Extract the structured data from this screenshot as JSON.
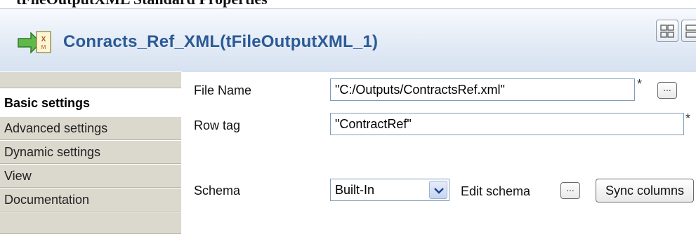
{
  "window": {
    "cut_heading": "tFileOutputXML Standard Properties",
    "title": "Conracts_Ref_XML(tFileOutputXML_1)",
    "view_buttons": [
      {
        "icon": "grid-view-icon"
      },
      {
        "icon": "list-view-icon"
      }
    ]
  },
  "sidebar": {
    "tabs": [
      {
        "label": "Basic settings",
        "active": true
      },
      {
        "label": "Advanced settings",
        "active": false
      },
      {
        "label": "Dynamic settings",
        "active": false
      },
      {
        "label": "View",
        "active": false
      },
      {
        "label": "Documentation",
        "active": false
      }
    ]
  },
  "form": {
    "file_name": {
      "label": "File Name",
      "value": "\"C:/Outputs/ContractsRef.xml\"",
      "required_marker": "*",
      "browse_label": "..."
    },
    "row_tag": {
      "label": "Row tag",
      "value": "\"ContractRef\"",
      "required_marker": "*"
    },
    "schema": {
      "label": "Schema",
      "selected": "Built-In",
      "edit_label": "Edit schema",
      "edit_button_label": "...",
      "sync_label": "Sync columns"
    }
  },
  "colors": {
    "title_text": "#2b5a96",
    "title_bar": "#e3ebf6",
    "tab_bg": "#dbd8ce"
  }
}
